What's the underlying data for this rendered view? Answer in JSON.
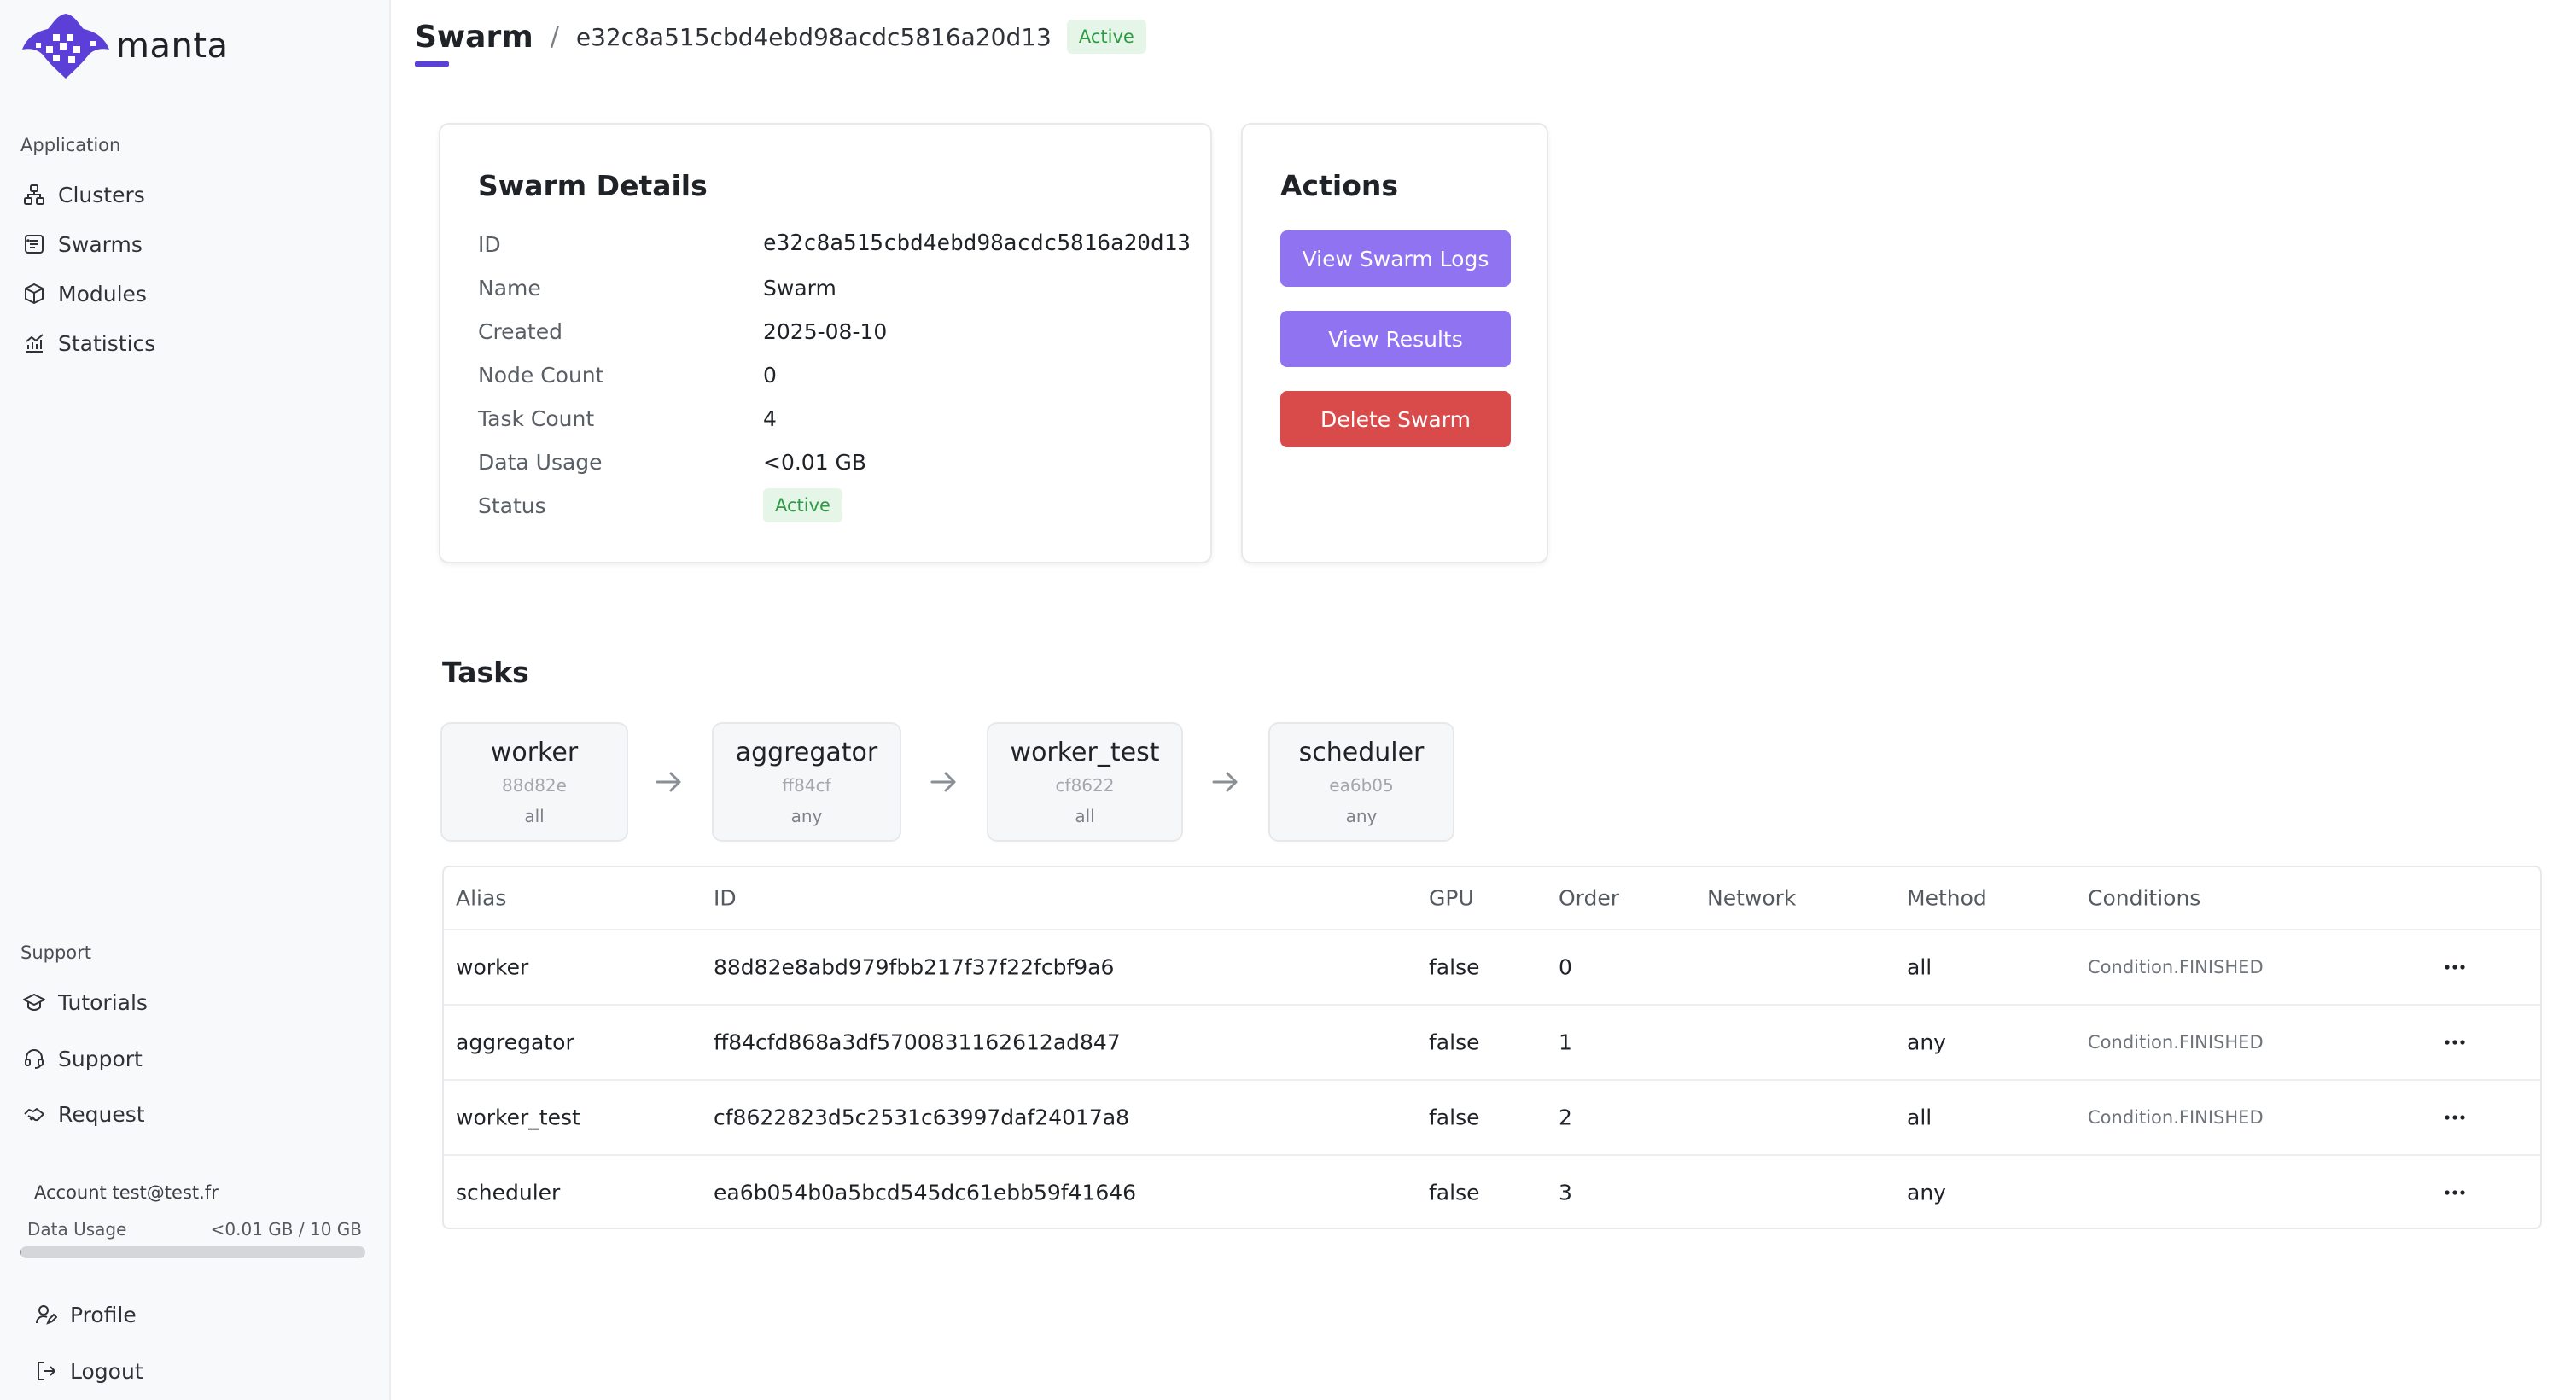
{
  "app": {
    "name": "manta"
  },
  "sidebar": {
    "application_label": "Application",
    "items": [
      {
        "label": "Clusters",
        "icon": "clusters-icon"
      },
      {
        "label": "Swarms",
        "icon": "swarms-icon"
      },
      {
        "label": "Modules",
        "icon": "cube-icon"
      },
      {
        "label": "Statistics",
        "icon": "chart-icon"
      }
    ],
    "support_label": "Support",
    "support_items": [
      {
        "label": "Tutorials",
        "icon": "graduation-cap-icon"
      },
      {
        "label": "Support",
        "icon": "headset-icon"
      },
      {
        "label": "Request",
        "icon": "handshake-icon"
      }
    ],
    "account": "Account test@test.fr",
    "usage": {
      "label": "Data Usage",
      "value": "<0.01 GB / 10 GB",
      "fraction": 0.001
    },
    "footer_items": [
      {
        "label": "Profile",
        "icon": "user-edit-icon"
      },
      {
        "label": "Logout",
        "icon": "logout-icon"
      }
    ]
  },
  "header": {
    "breadcrumb_root": "Swarm",
    "separator": "/",
    "swarm_id": "e32c8a515cbd4ebd98acdc5816a20d13",
    "status": "Active"
  },
  "details": {
    "title": "Swarm Details",
    "fields": [
      {
        "label": "ID",
        "value": "e32c8a515cbd4ebd98acdc5816a20d13"
      },
      {
        "label": "Name",
        "value": "Swarm"
      },
      {
        "label": "Created",
        "value": "2025-08-10"
      },
      {
        "label": "Node Count",
        "value": "0"
      },
      {
        "label": "Task Count",
        "value": "4"
      },
      {
        "label": "Data Usage",
        "value": "<0.01 GB"
      },
      {
        "label": "Status",
        "value": "Active"
      }
    ]
  },
  "actions": {
    "title": "Actions",
    "view_logs": "View Swarm Logs",
    "view_results": "View Results",
    "delete": "Delete Swarm"
  },
  "tasks": {
    "title": "Tasks",
    "flow": [
      {
        "name": "worker",
        "short_id": "88d82e",
        "method": "all"
      },
      {
        "name": "aggregator",
        "short_id": "ff84cf",
        "method": "any"
      },
      {
        "name": "worker_test",
        "short_id": "cf8622",
        "method": "all"
      },
      {
        "name": "scheduler",
        "short_id": "ea6b05",
        "method": "any"
      }
    ],
    "columns": [
      "Alias",
      "ID",
      "GPU",
      "Order",
      "Network",
      "Method",
      "Conditions"
    ],
    "rows": [
      {
        "alias": "worker",
        "id": "88d82e8abd979fbb217f37f22fcbf9a6",
        "gpu": "false",
        "order": "0",
        "network": "",
        "method": "all",
        "conditions": "Condition.FINISHED"
      },
      {
        "alias": "aggregator",
        "id": "ff84cfd868a3df5700831162612ad847",
        "gpu": "false",
        "order": "1",
        "network": "",
        "method": "any",
        "conditions": "Condition.FINISHED"
      },
      {
        "alias": "worker_test",
        "id": "cf8622823d5c2531c63997daf24017a8",
        "gpu": "false",
        "order": "2",
        "network": "",
        "method": "all",
        "conditions": "Condition.FINISHED"
      },
      {
        "alias": "scheduler",
        "id": "ea6b054b0a5bcd545dc61ebb59f41646",
        "gpu": "false",
        "order": "3",
        "network": "",
        "method": "any",
        "conditions": ""
      }
    ]
  },
  "colors": {
    "accent": "#8f73f0",
    "brand": "#5b3fd6",
    "danger": "#d94a4a",
    "success_bg": "#e5f6e8",
    "success_text": "#2f9a44"
  }
}
